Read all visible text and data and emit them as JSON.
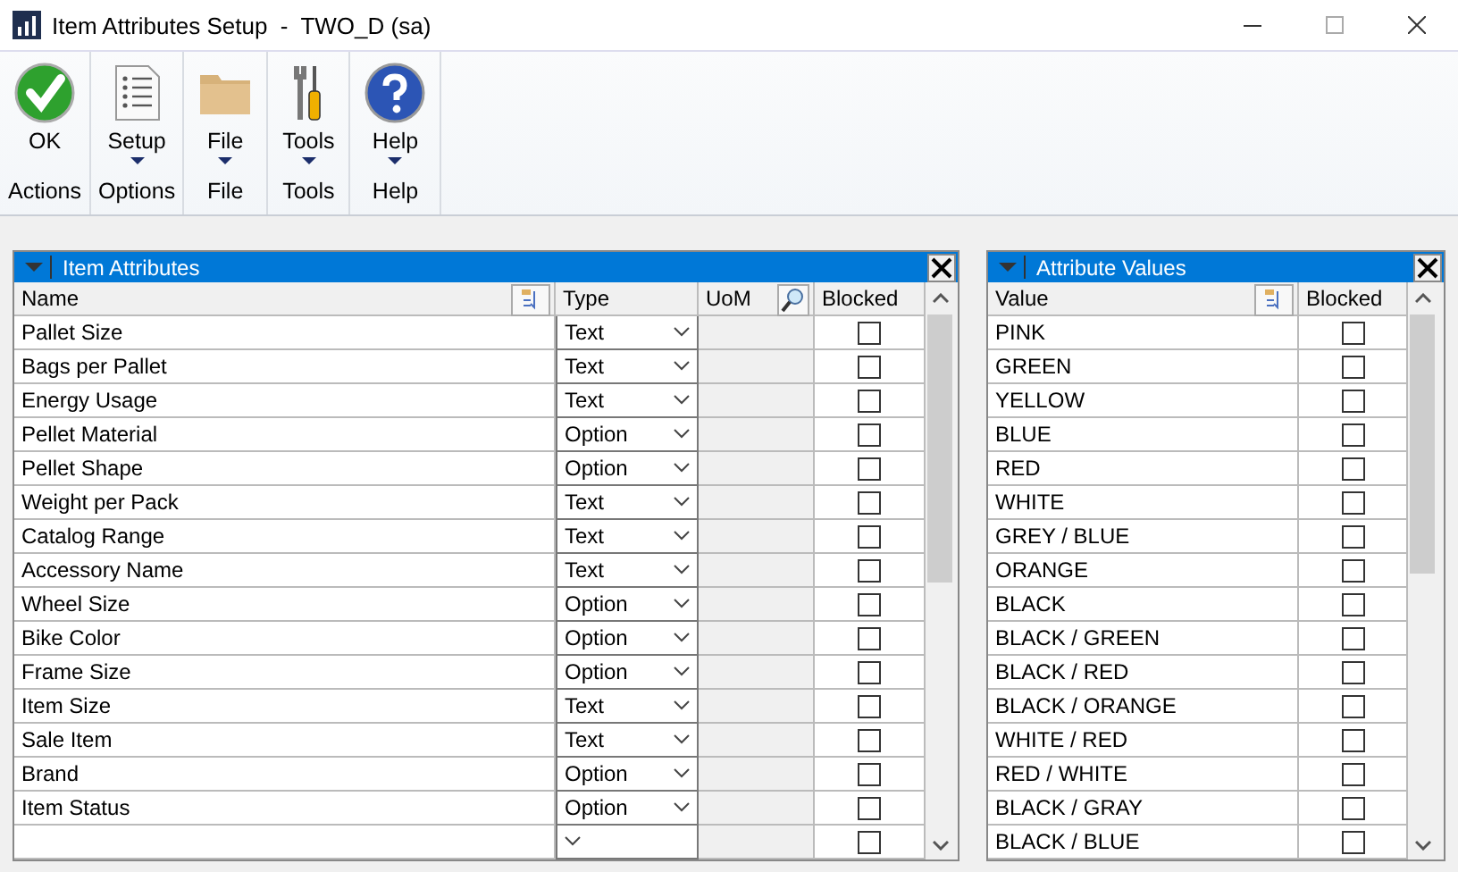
{
  "window": {
    "title": "Item Attributes Setup  -  TWO_D (sa)"
  },
  "ribbon": [
    {
      "kind": "ok",
      "label": "OK",
      "menu": false,
      "group": "Actions"
    },
    {
      "kind": "list",
      "label": "Setup",
      "menu": true,
      "group": "Options"
    },
    {
      "kind": "folder",
      "label": "File",
      "menu": true,
      "group": "File"
    },
    {
      "kind": "tools",
      "label": "Tools",
      "menu": true,
      "group": "Tools"
    },
    {
      "kind": "help",
      "label": "Help",
      "menu": true,
      "group": "Help"
    }
  ],
  "attributes": {
    "title": "Item Attributes",
    "columns": [
      "Name",
      "Type",
      "UoM",
      "Blocked"
    ],
    "rows": [
      {
        "name": "Pallet Size",
        "type": "Text",
        "blocked": false
      },
      {
        "name": "Bags per Pallet",
        "type": "Text",
        "blocked": false
      },
      {
        "name": "Energy Usage",
        "type": "Text",
        "blocked": false
      },
      {
        "name": "Pellet Material",
        "type": "Option",
        "blocked": false
      },
      {
        "name": "Pellet Shape",
        "type": "Option",
        "blocked": false
      },
      {
        "name": "Weight per Pack",
        "type": "Text",
        "blocked": false
      },
      {
        "name": "Catalog Range",
        "type": "Text",
        "blocked": false
      },
      {
        "name": "Accessory Name",
        "type": "Text",
        "blocked": false
      },
      {
        "name": "Wheel Size",
        "type": "Option",
        "blocked": false
      },
      {
        "name": "Bike Color",
        "type": "Option",
        "blocked": false
      },
      {
        "name": "Frame Size",
        "type": "Option",
        "blocked": false
      },
      {
        "name": "Item Size",
        "type": "Text",
        "blocked": false
      },
      {
        "name": "Sale Item",
        "type": "Text",
        "blocked": false
      },
      {
        "name": "Brand",
        "type": "Option",
        "blocked": false
      },
      {
        "name": "Item Status",
        "type": "Option",
        "blocked": false
      },
      {
        "blocked": false
      }
    ]
  },
  "values": {
    "title": "Attribute Values",
    "columns": [
      "Value",
      "Blocked"
    ],
    "rows": [
      {
        "value": "PINK",
        "blocked": false
      },
      {
        "value": "GREEN",
        "blocked": false
      },
      {
        "value": "YELLOW",
        "blocked": false
      },
      {
        "value": "BLUE",
        "blocked": false
      },
      {
        "value": "RED",
        "blocked": false
      },
      {
        "value": "WHITE",
        "blocked": false
      },
      {
        "value": "GREY / BLUE",
        "blocked": false
      },
      {
        "value": "ORANGE",
        "blocked": false
      },
      {
        "value": "BLACK",
        "blocked": false
      },
      {
        "value": "BLACK / GREEN",
        "blocked": false
      },
      {
        "value": "BLACK / RED",
        "blocked": false
      },
      {
        "value": "BLACK / ORANGE",
        "blocked": false
      },
      {
        "value": "WHITE / RED",
        "blocked": false
      },
      {
        "value": "RED / WHITE",
        "blocked": false
      },
      {
        "value": "BLACK / GRAY",
        "blocked": false
      },
      {
        "value": "BLACK / BLUE",
        "blocked": false
      }
    ]
  }
}
